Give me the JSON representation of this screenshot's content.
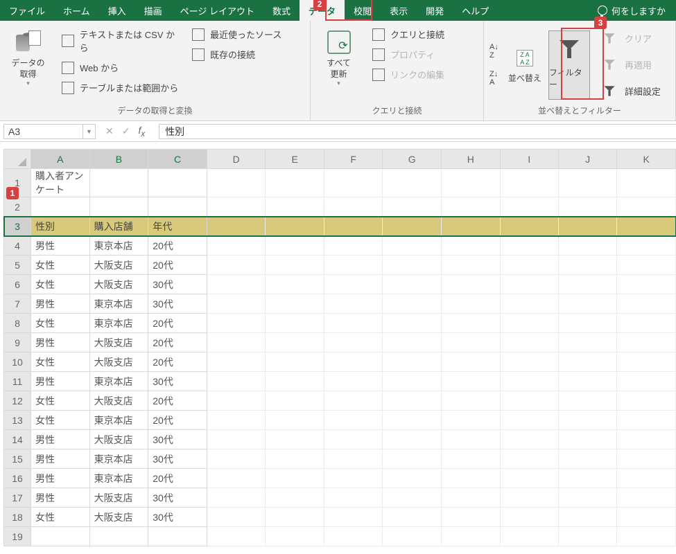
{
  "tabs": [
    "ファイル",
    "ホーム",
    "挿入",
    "描画",
    "ページ レイアウト",
    "数式",
    "データ",
    "校閲",
    "表示",
    "開発",
    "ヘルプ"
  ],
  "activeTab": 6,
  "tellMe": "何をしますか",
  "ribbon": {
    "group1": {
      "label": "データの取得と変換",
      "getData": "データの\n取得",
      "items": [
        "テキストまたは CSV から",
        "Web から",
        "テーブルまたは範囲から"
      ],
      "right": [
        "最近使ったソース",
        "既存の接続"
      ]
    },
    "group2": {
      "label": "クエリと接続",
      "refresh": "すべて\n更新",
      "items": [
        "クエリと接続",
        "プロパティ",
        "リンクの編集"
      ]
    },
    "group3": {
      "label": "並べ替えとフィルター",
      "sortBtn": "並べ替え",
      "filterBtn": "フィルター",
      "clear": "クリア",
      "reapply": "再適用",
      "advanced": "詳細設定"
    }
  },
  "nameBox": "A3",
  "formula": "性別",
  "columns": [
    "A",
    "B",
    "C",
    "D",
    "E",
    "F",
    "G",
    "H",
    "I",
    "J",
    "K"
  ],
  "rows": [
    {
      "n": 1,
      "cells": [
        "購入者アンケート",
        "",
        ""
      ]
    },
    {
      "n": 2,
      "cells": [
        "",
        "",
        ""
      ]
    },
    {
      "n": 3,
      "cells": [
        "性別",
        "購入店舗",
        "年代"
      ],
      "header": true,
      "selected": true
    },
    {
      "n": 4,
      "cells": [
        "男性",
        "東京本店",
        "20代"
      ]
    },
    {
      "n": 5,
      "cells": [
        "女性",
        "大阪支店",
        "20代"
      ]
    },
    {
      "n": 6,
      "cells": [
        "女性",
        "大阪支店",
        "30代"
      ]
    },
    {
      "n": 7,
      "cells": [
        "男性",
        "東京本店",
        "30代"
      ]
    },
    {
      "n": 8,
      "cells": [
        "女性",
        "東京本店",
        "20代"
      ]
    },
    {
      "n": 9,
      "cells": [
        "男性",
        "大阪支店",
        "20代"
      ]
    },
    {
      "n": 10,
      "cells": [
        "女性",
        "大阪支店",
        "20代"
      ]
    },
    {
      "n": 11,
      "cells": [
        "男性",
        "東京本店",
        "30代"
      ]
    },
    {
      "n": 12,
      "cells": [
        "女性",
        "大阪支店",
        "20代"
      ]
    },
    {
      "n": 13,
      "cells": [
        "女性",
        "東京本店",
        "20代"
      ]
    },
    {
      "n": 14,
      "cells": [
        "男性",
        "大阪支店",
        "30代"
      ]
    },
    {
      "n": 15,
      "cells": [
        "男性",
        "東京本店",
        "30代"
      ]
    },
    {
      "n": 16,
      "cells": [
        "男性",
        "東京本店",
        "20代"
      ]
    },
    {
      "n": 17,
      "cells": [
        "男性",
        "大阪支店",
        "30代"
      ]
    },
    {
      "n": 18,
      "cells": [
        "女性",
        "大阪支店",
        "30代"
      ]
    },
    {
      "n": 19,
      "cells": [
        "",
        "",
        ""
      ]
    }
  ],
  "callouts": {
    "1": "1",
    "2": "2",
    "3": "3"
  }
}
